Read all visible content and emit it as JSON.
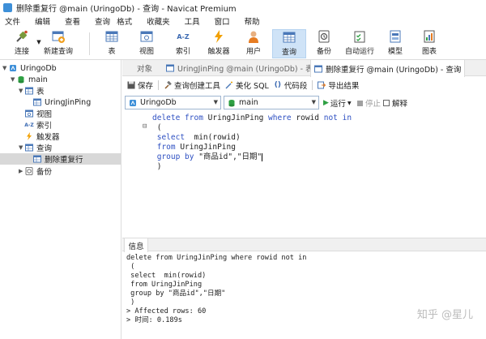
{
  "window": {
    "title": "删除重复行 @main (UringoDb) - 查询 - Navicat Premium"
  },
  "menu": [
    "文件",
    "编辑",
    "查看",
    "查询",
    "格式",
    "收藏夹",
    "工具",
    "窗口",
    "帮助"
  ],
  "toolbar": {
    "connect": "连接",
    "new_query": "新建查询",
    "table": "表",
    "view": "视图",
    "index": "索引",
    "trigger": "触发器",
    "user": "用户",
    "query": "查询",
    "backup": "备份",
    "autorun": "自动运行",
    "model": "模型",
    "chart": "图表",
    "index_icon_text": "A-Z"
  },
  "sidebar": {
    "connection": "UringoDb",
    "database": "main",
    "tables_group": "表",
    "table_item": "UringJinPing",
    "views_group": "视图",
    "indexes_group": "索引",
    "triggers_group": "触发器",
    "queries_group": "查询",
    "query_item": "删除重复行",
    "backups_group": "备份",
    "index_icon_text": "A-Z"
  },
  "tabs": {
    "objects": "对象",
    "table_tab": "UringJinPing @main (UringoDb) - 表",
    "query_tab": "删除重复行 @main (UringoDb) - 查询"
  },
  "query_toolbar": {
    "save": "保存",
    "builder": "查询创建工具",
    "beautify": "美化 SQL",
    "snippet": "代码段",
    "export": "导出结果",
    "snippet_icon": "()"
  },
  "selectors": {
    "connection": "UringoDb",
    "database": "main",
    "run": "运行",
    "stop": "停止",
    "explain": "解释"
  },
  "editor": {
    "l1_kw1": "delete from",
    "l1_t1": "UringJinPing",
    "l1_kw2": "where",
    "l1_t2": "rowid",
    "l1_kw3": "not in",
    "l2": " (",
    "l3_kw": " select",
    "l3_t": "  min(rowid)",
    "l4_kw": " from",
    "l4_t": " UringJinPing",
    "l5_kw": " group by",
    "l5_t": " \"商品id\",\"日期\"",
    "l6": " )"
  },
  "info": {
    "tab": "信息",
    "lines": [
      "delete from UringJinPing where rowid not in",
      " (",
      " select  min(rowid)",
      " from UringJinPing",
      " group by \"商品id\",\"日期\"",
      " )",
      "> Affected rows: 60",
      "> 时间: 0.189s"
    ]
  },
  "watermark": "知乎 @星儿",
  "colors": {
    "keyword": "#2d4fc2",
    "accent": "#3d8fd8",
    "run_green": "#2ea043"
  }
}
